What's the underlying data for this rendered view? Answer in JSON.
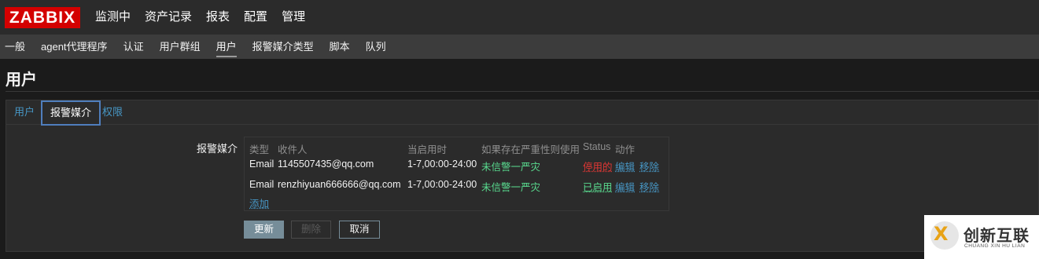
{
  "brand": {
    "logo": "ZABBIX",
    "color": "#d40000"
  },
  "main_menu": [
    "监测中",
    "资产记录",
    "报表",
    "配置",
    "管理"
  ],
  "sub_menu": {
    "items": [
      "一般",
      "agent代理程序",
      "认证",
      "用户群组",
      "用户",
      "报警媒介类型",
      "脚本",
      "队列"
    ],
    "active": "用户"
  },
  "page": {
    "title": "用户"
  },
  "tabs": {
    "items": [
      "用户",
      "报警媒介",
      "权限"
    ],
    "active": "报警媒介"
  },
  "form": {
    "label": "报警媒介"
  },
  "media_table": {
    "headers": [
      "类型",
      "收件人",
      "当启用时",
      "如果存在严重性则使用",
      "Status",
      "动作"
    ],
    "rows": [
      {
        "type": "Email",
        "recipient": "1145507435@qq.com",
        "when_active": "1-7,00:00-24:00",
        "severity": "未信警一严灾",
        "status": "停用的",
        "status_color": "#e33734",
        "action_edit": "编辑",
        "action_remove": "移除"
      },
      {
        "type": "Email",
        "recipient": "renzhiyuan666666@qq.com",
        "when_active": "1-7,00:00-24:00",
        "severity": "未信警一严灾",
        "status": "已启用",
        "status_color": "#59db8f",
        "action_edit": "编辑",
        "action_remove": "移除"
      }
    ],
    "add_link": "添加"
  },
  "buttons": {
    "update": "更新",
    "delete": "删除",
    "cancel": "取消"
  },
  "watermark": {
    "chinese": "创新互联",
    "english": "CHUANG XIN HU LIAN",
    "mark": "X"
  }
}
